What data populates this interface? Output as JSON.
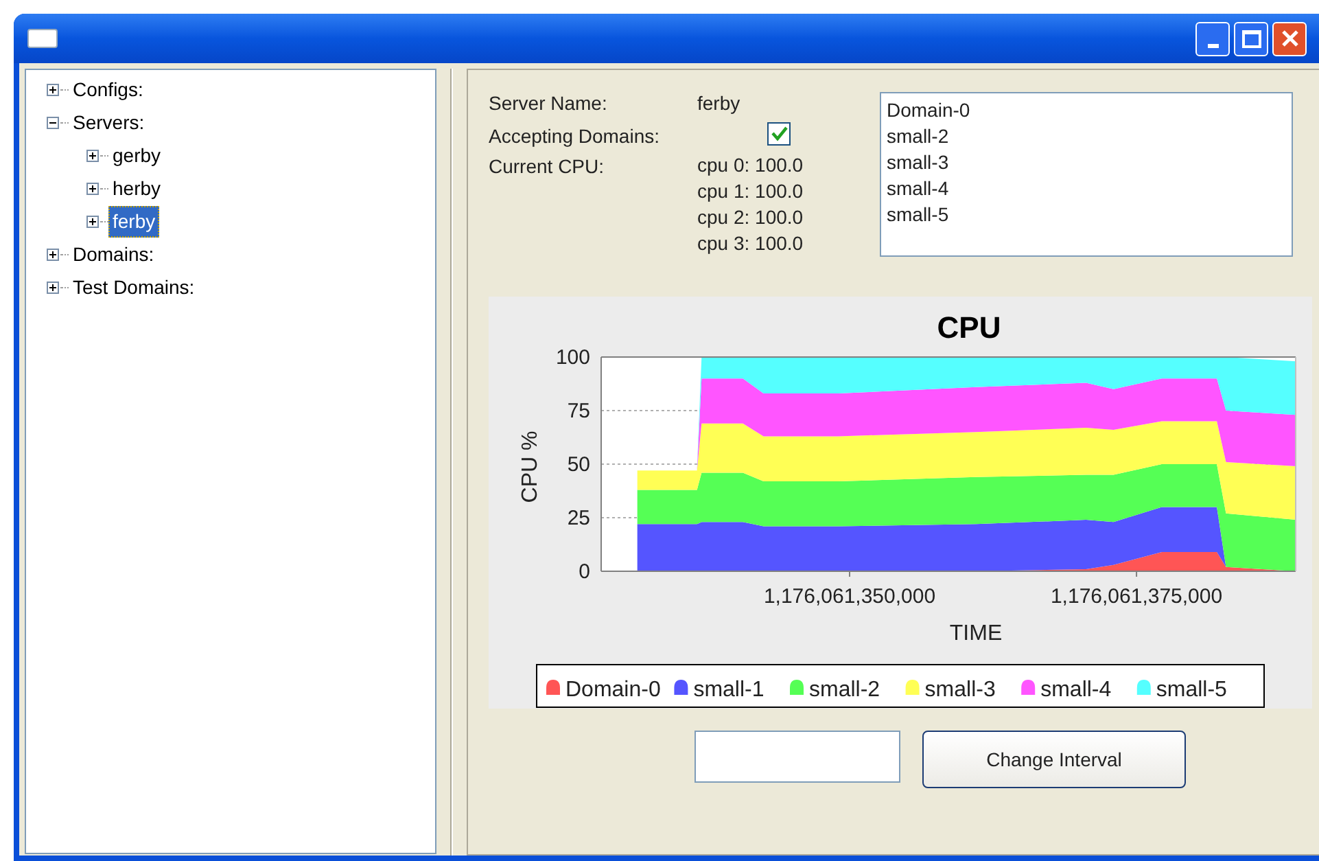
{
  "tree": [
    {
      "label": "Configs:",
      "expanded": false,
      "selected": false
    },
    {
      "label": "Servers:",
      "expanded": true,
      "selected": false,
      "children": [
        {
          "label": "gerby",
          "expanded": false,
          "selected": false
        },
        {
          "label": "herby",
          "expanded": false,
          "selected": false
        },
        {
          "label": "ferby",
          "expanded": false,
          "selected": true
        }
      ]
    },
    {
      "label": "Domains:",
      "expanded": false,
      "selected": false
    },
    {
      "label": "Test Domains:",
      "expanded": false,
      "selected": false
    }
  ],
  "details": {
    "server_name_label": "Server Name:",
    "server_name": "ferby",
    "accepting_label": "Accepting Domains:",
    "accepting": true,
    "cpu_label": "Current CPU:",
    "cpus": [
      "cpu 0: 100.0",
      "cpu 1: 100.0",
      "cpu 2: 100.0",
      "cpu 3: 100.0"
    ]
  },
  "domain_list": [
    {
      "label": "Domain-0",
      "selected": false
    },
    {
      "label": "small-2",
      "selected": false
    },
    {
      "label": "small-3",
      "selected": false
    },
    {
      "label": "small-4",
      "selected": false
    },
    {
      "label": "small-5",
      "selected": false
    }
  ],
  "chart_data": {
    "type": "area",
    "stacked": true,
    "title": "CPU",
    "xlabel": "TIME",
    "ylabel": "CPU %",
    "x": [
      1176061331500,
      1176061336700,
      1176061337100,
      1176061340700,
      1176061342500,
      1176061349000,
      1176061361000,
      1176061370600,
      1176061373000,
      1176061377200,
      1176061382000,
      1176061382800,
      1176061388900
    ],
    "series": [
      {
        "name": "Domain-0",
        "color": "#ff5555",
        "values": [
          0,
          0,
          0,
          0,
          0,
          0,
          0,
          1,
          3,
          9,
          9,
          2,
          0
        ]
      },
      {
        "name": "small-1",
        "color": "#5555ff",
        "values": [
          22,
          22,
          23,
          23,
          21,
          21,
          22,
          23,
          20,
          21,
          21,
          0,
          0
        ]
      },
      {
        "name": "small-2",
        "color": "#55ff55",
        "values": [
          16,
          16,
          23,
          23,
          21,
          21,
          22,
          21,
          22,
          20,
          20,
          25,
          24
        ]
      },
      {
        "name": "small-3",
        "color": "#ffff55",
        "values": [
          9,
          9,
          23,
          23,
          21,
          21,
          21,
          22,
          21,
          20,
          20,
          24,
          25
        ]
      },
      {
        "name": "small-4",
        "color": "#ff55ff",
        "values": [
          0,
          0,
          21,
          21,
          20,
          20,
          21,
          21,
          19,
          20,
          20,
          24,
          24
        ]
      },
      {
        "name": "small-5",
        "color": "#55ffff",
        "values": [
          0,
          0,
          10,
          10,
          17,
          17,
          14,
          12,
          15,
          10,
          10,
          25,
          25
        ]
      }
    ],
    "xlim": [
      1176061328350,
      1176061388870
    ],
    "ylim": [
      0,
      100
    ],
    "xticks": [
      {
        "value": 1176061350000,
        "label": "1,176,061,350,000"
      },
      {
        "value": 1176061375000,
        "label": "1,176,061,375,000"
      }
    ],
    "yticks": [
      0,
      25,
      50,
      75,
      100
    ],
    "grid": true,
    "legend": true
  },
  "button": "Change Interval"
}
